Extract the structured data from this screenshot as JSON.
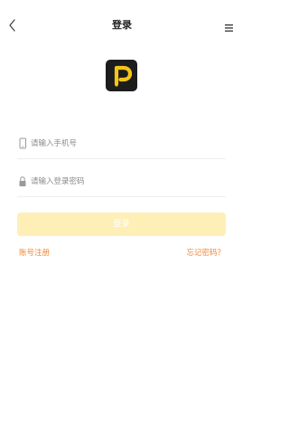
{
  "header": {
    "title": "登录",
    "back_icon": "chevron-left-icon",
    "menu_icon": "menu-icon"
  },
  "logo": {
    "icon": "app-logo-p",
    "background": "#1d1d1d",
    "accent": "#f5c518"
  },
  "form": {
    "phone_placeholder": "请输入手机号",
    "phone_value": "",
    "phone_icon": "phone-icon",
    "password_placeholder": "请输入登录密码",
    "password_value": "",
    "password_icon": "lock-icon"
  },
  "login_button": {
    "label": "登录",
    "color": "#fdefb6",
    "state": "disabled"
  },
  "links": {
    "register": "账号注册",
    "forgot_password": "忘记密码？",
    "color": "#f08a3c"
  }
}
